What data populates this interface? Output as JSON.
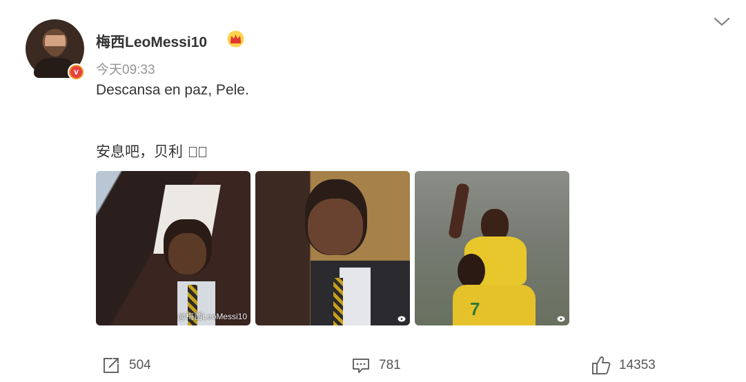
{
  "post": {
    "author": "梅西LeoMessi10",
    "verified_label": "v",
    "timestamp": "今天09:33",
    "text_line1": "Descansa en paz, Pele.",
    "text_line2": "安息吧，贝利",
    "watermark": "@梅西LeoMessi10",
    "images": [
      {
        "name": "photo-pele-smiling-suit"
      },
      {
        "name": "photo-pele-hugging"
      },
      {
        "name": "photo-pele-celebrating-brazil"
      }
    ]
  },
  "actions": {
    "share_count": "504",
    "comment_count": "781",
    "like_count": "14353"
  },
  "icons": {
    "expand": "chevron-down-icon",
    "badge": "crown-icon",
    "share": "share-icon",
    "comment": "comment-icon",
    "like": "thumbs-up-icon"
  },
  "colors": {
    "text": "#333333",
    "muted": "#939393",
    "verified_orange": "#f2921f",
    "icon_gray": "#666666"
  }
}
